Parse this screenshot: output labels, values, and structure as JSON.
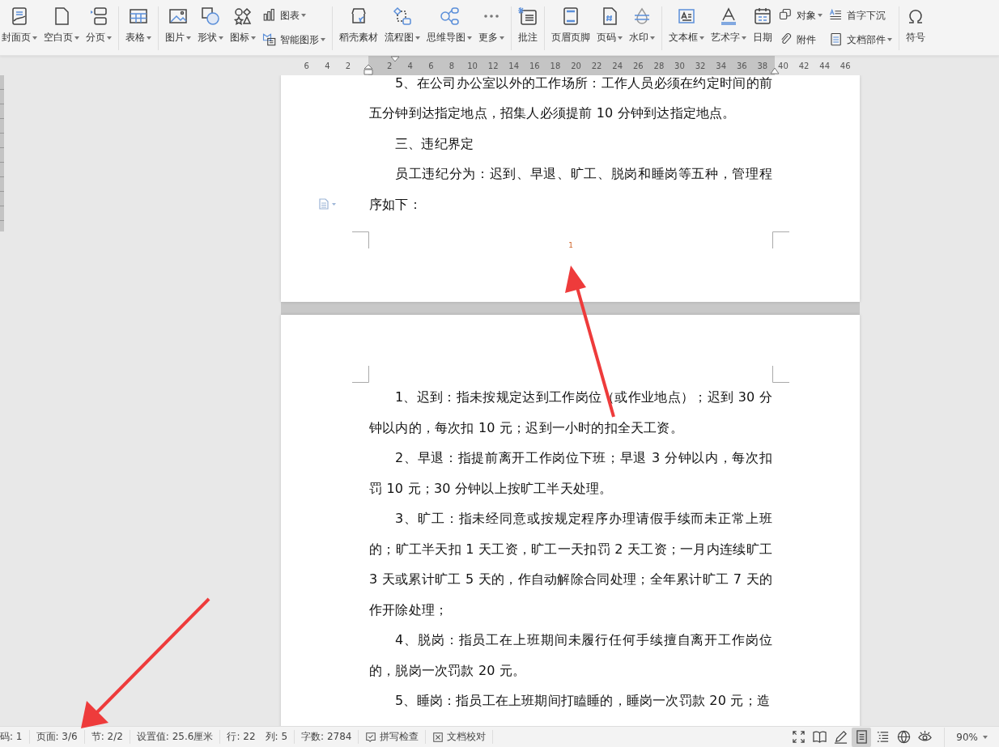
{
  "toolbar": {
    "groups": [
      {
        "items": [
          {
            "kind": "large",
            "label": "封面页",
            "dropdown": true
          },
          {
            "kind": "large",
            "label": "空白页",
            "dropdown": true
          },
          {
            "kind": "large",
            "label": "分页",
            "dropdown": true
          }
        ]
      },
      {
        "items": [
          {
            "kind": "large",
            "label": "表格",
            "dropdown": true
          }
        ]
      },
      {
        "items": [
          {
            "kind": "large",
            "label": "图片",
            "dropdown": true
          },
          {
            "kind": "large",
            "label": "形状",
            "dropdown": true
          },
          {
            "kind": "large",
            "label": "图标",
            "dropdown": true
          },
          {
            "kind": "stack",
            "items": [
              {
                "label": "图表",
                "dropdown": true
              },
              {
                "label": "智能图形",
                "dropdown": true
              }
            ]
          }
        ]
      },
      {
        "items": [
          {
            "kind": "large",
            "label": "稻壳素材",
            "dropdown": false
          },
          {
            "kind": "large",
            "label": "流程图",
            "dropdown": true
          },
          {
            "kind": "large",
            "label": "思维导图",
            "dropdown": true
          },
          {
            "kind": "large",
            "label": "更多",
            "dropdown": true
          }
        ]
      },
      {
        "items": [
          {
            "kind": "large",
            "label": "批注",
            "dropdown": false
          }
        ]
      },
      {
        "items": [
          {
            "kind": "large",
            "label": "页眉页脚",
            "dropdown": false
          },
          {
            "kind": "large",
            "label": "页码",
            "dropdown": true
          },
          {
            "kind": "large",
            "label": "水印",
            "dropdown": true
          }
        ]
      },
      {
        "items": [
          {
            "kind": "large",
            "label": "文本框",
            "dropdown": true
          },
          {
            "kind": "large",
            "label": "艺术字",
            "dropdown": true
          },
          {
            "kind": "large",
            "label": "日期",
            "dropdown": false
          },
          {
            "kind": "stack",
            "items": [
              {
                "label": "对象",
                "dropdown": true
              },
              {
                "label": "附件",
                "dropdown": false
              }
            ]
          },
          {
            "kind": "stack",
            "items": [
              {
                "label": "首字下沉",
                "dropdown": false
              },
              {
                "label": "文档部件",
                "dropdown": true
              }
            ]
          }
        ]
      },
      {
        "items": [
          {
            "kind": "large",
            "label": "符号",
            "dropdown": false
          }
        ]
      }
    ]
  },
  "ruler": {
    "left_ticks": [
      "6",
      "4",
      "2"
    ],
    "ticks": [
      "2",
      "4",
      "6",
      "8",
      "10",
      "12",
      "14",
      "16",
      "18",
      "20",
      "22",
      "24",
      "26",
      "28",
      "30",
      "32",
      "34",
      "36",
      "38"
    ],
    "right_ticks": [
      "40",
      "42",
      "44",
      "46"
    ]
  },
  "pages": [
    {
      "paragraphs": [
        {
          "text": "5、在公司办公室以外的工作场所：工作人员必须在约定时间的前五分钟到达指定地点，招集人必须提前 10 分钟到达指定地点。",
          "marker": false
        },
        {
          "text": "三、违纪界定",
          "marker": false
        },
        {
          "text": "员工违纪分为：迟到、早退、旷工、脱岗和睡岗等五种，管理程序如下：",
          "marker": true
        }
      ],
      "page_number": "1"
    },
    {
      "paragraphs": [
        {
          "text": "1、迟到：指未按规定达到工作岗位（或作业地点）；迟到 30 分钟以内的，每次扣 10 元；迟到一小时的扣全天工资。",
          "marker": false
        },
        {
          "text": "2、早退：指提前离开工作岗位下班；早退 3 分钟以内，每次扣罚 10 元；30 分钟以上按旷工半天处理。",
          "marker": false
        },
        {
          "text": "3、旷工：指未经同意或按规定程序办理请假手续而未正常上班的；旷工半天扣 1 天工资，旷工一天扣罚 2 天工资；一月内连续旷工 3 天或累计旷工 5 天的，作自动解除合同处理；全年累计旷工 7 天的作开除处理；",
          "marker": false
        },
        {
          "text": "4、脱岗：指员工在上班期间未履行任何手续擅自离开工作岗位的，脱岗一次罚款 20 元。",
          "marker": false
        },
        {
          "text": "5、睡岗：指员工在上班期间打瞌睡的，睡岗一次罚款 20 元；造",
          "marker": false
        }
      ]
    }
  ],
  "status_bar": {
    "fields": [
      {
        "texts": [
          "码: 1"
        ]
      },
      {
        "texts": [
          "页面: 3/6"
        ]
      },
      {
        "texts": [
          "节: 2/2"
        ]
      },
      {
        "texts": [
          "设置值: 25.6厘米"
        ]
      },
      {
        "texts": [
          "行: 22",
          "列: 5"
        ]
      },
      {
        "texts": [
          "字数: 2784"
        ]
      }
    ],
    "buttons": [
      {
        "label": "拼写检查"
      },
      {
        "label": "文档校对"
      }
    ],
    "views": [
      {
        "selected": false
      },
      {
        "selected": false
      },
      {
        "selected": false
      },
      {
        "selected": true
      },
      {
        "selected": false
      },
      {
        "selected": false
      },
      {
        "selected": false
      }
    ],
    "zoom": "90%"
  }
}
